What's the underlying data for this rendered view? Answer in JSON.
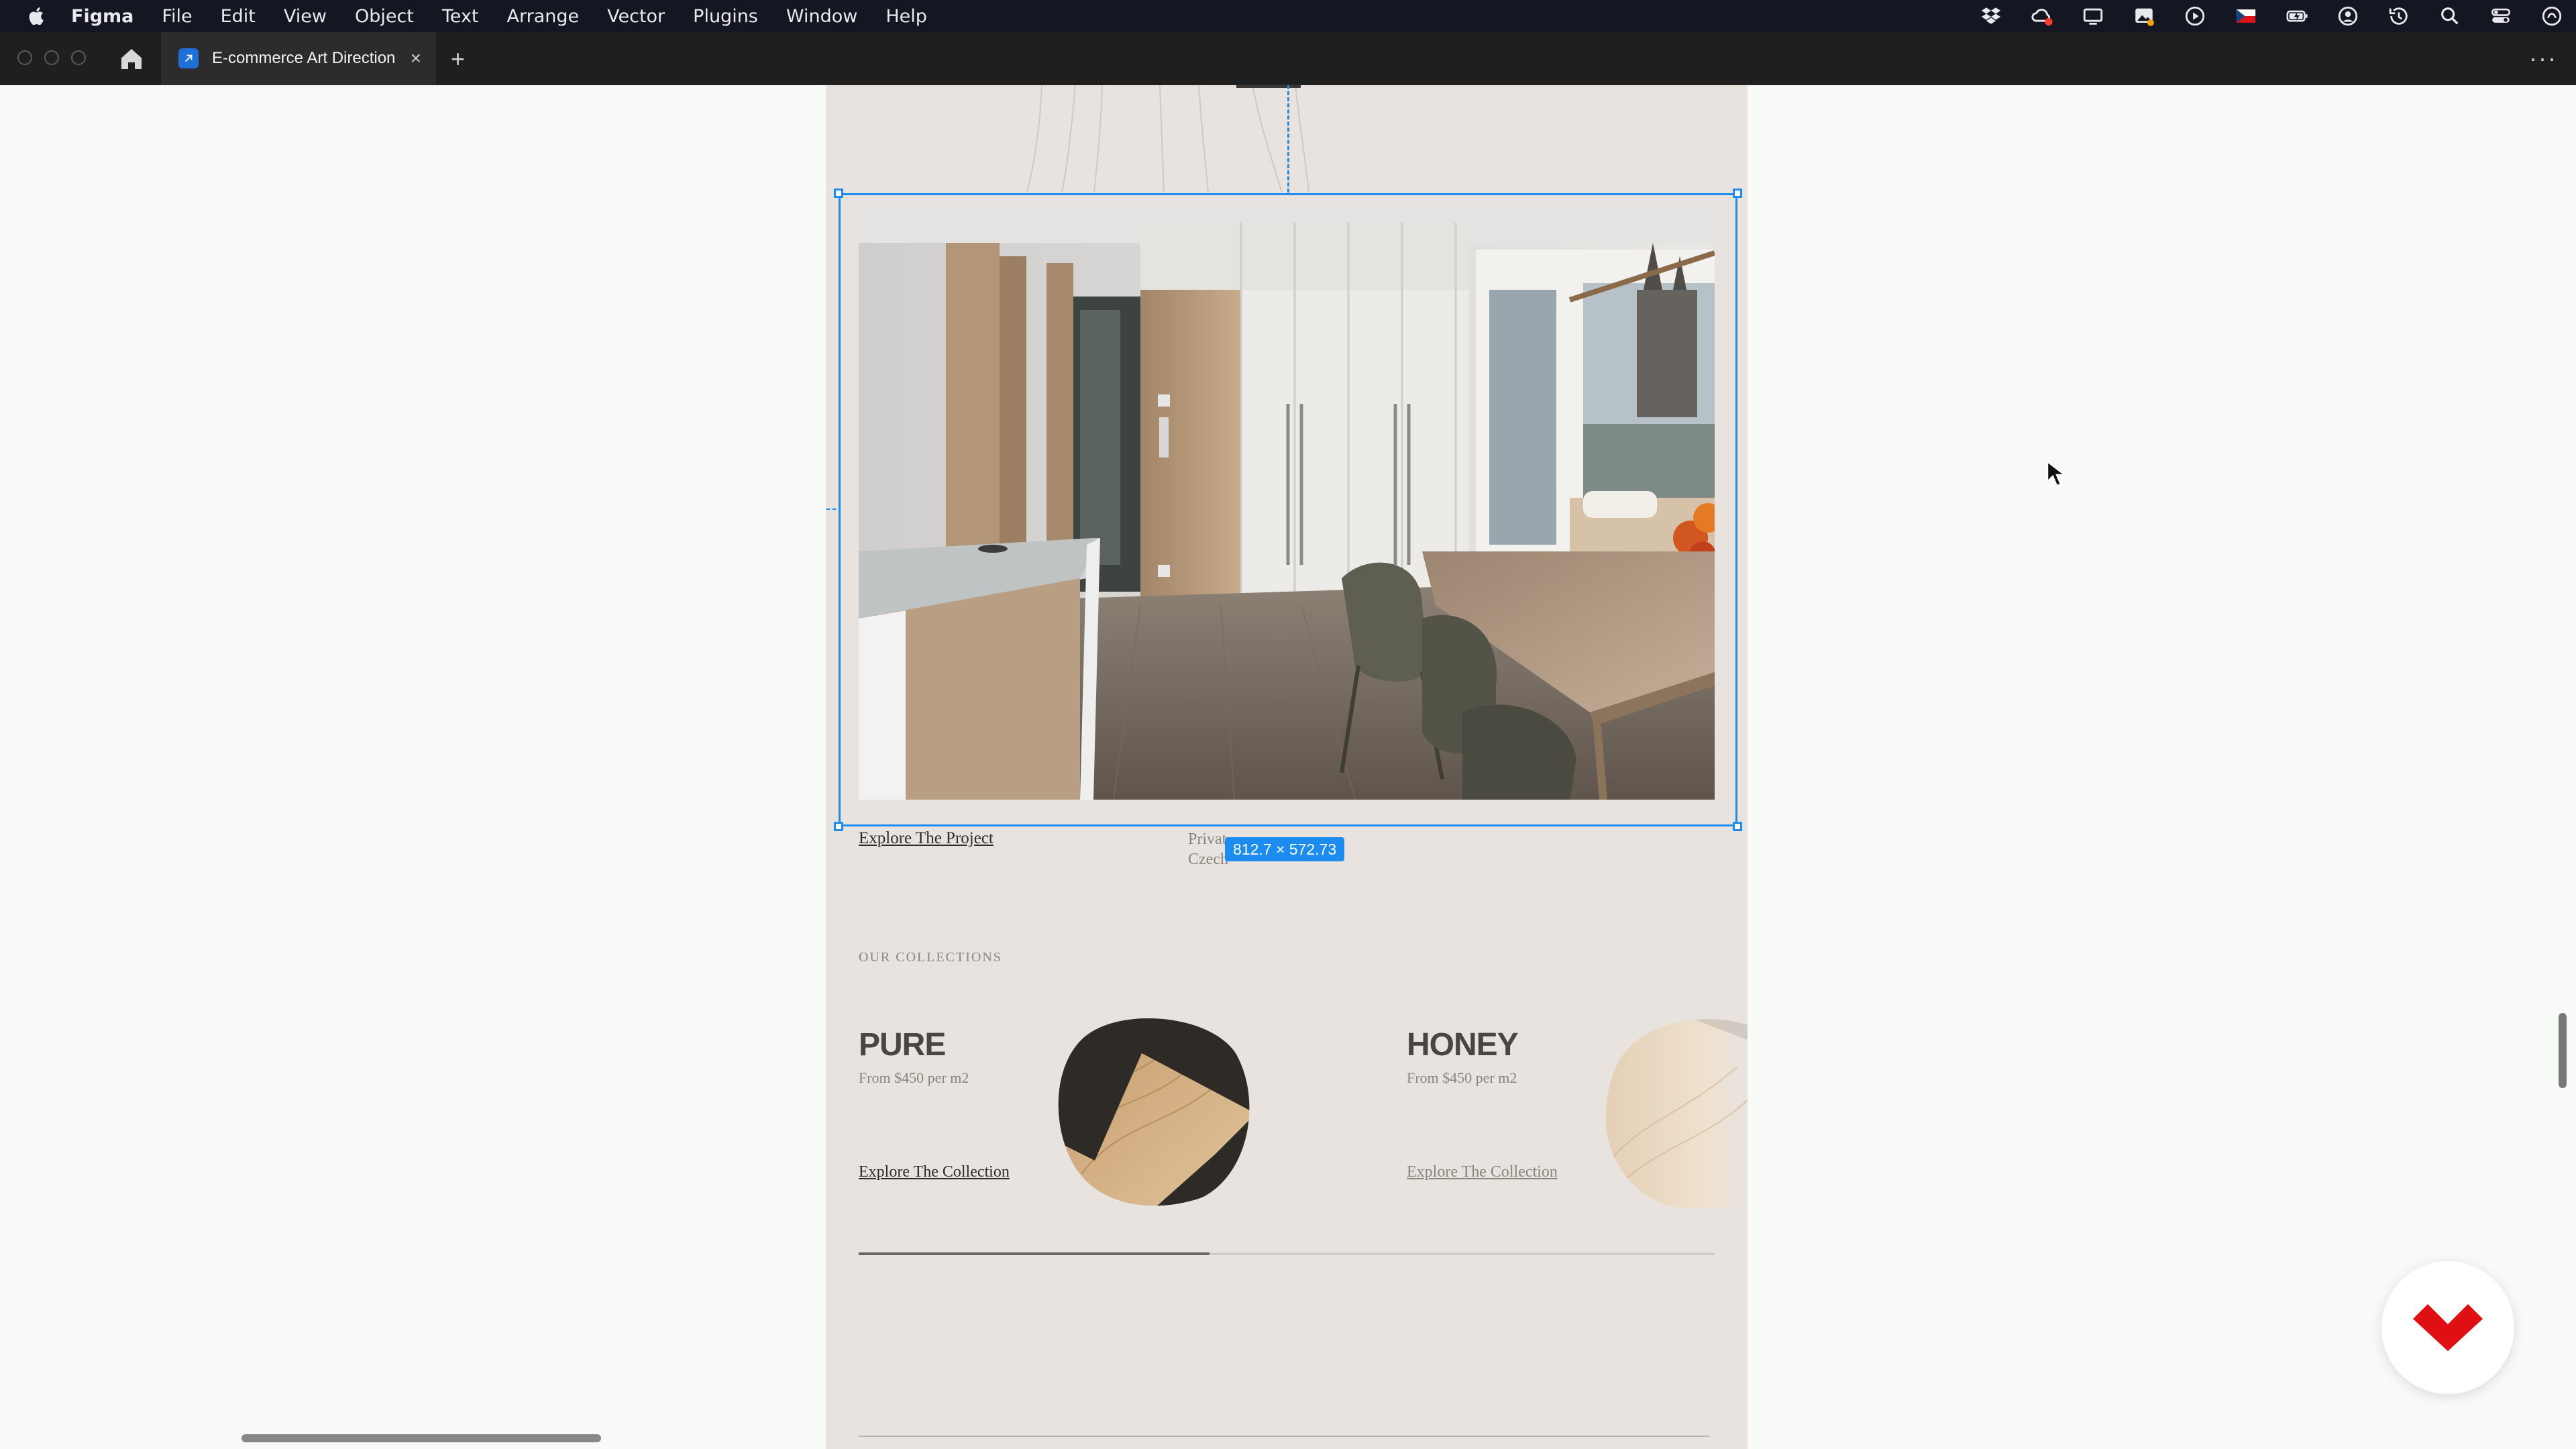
{
  "menubar": {
    "app_name": "Figma",
    "items": [
      "File",
      "Edit",
      "View",
      "Object",
      "Text",
      "Arrange",
      "Vector",
      "Plugins",
      "Window",
      "Help"
    ],
    "status_icons": [
      "dropbox-icon",
      "creative-cloud-icon",
      "display-icon",
      "photos-icon",
      "play-icon",
      "czech-flag-icon",
      "battery-icon",
      "user-icon",
      "time-machine-icon",
      "search-icon",
      "control-center-icon",
      "siri-icon"
    ]
  },
  "tabbar": {
    "tab_title": "E-commerce Art Direction",
    "close_glyph": "×",
    "new_tab_glyph": "+",
    "more_glyph": "···"
  },
  "canvas": {
    "selection_size": "812.7 × 572.73",
    "project_link": "Explore The Project",
    "project_caption_line1": "Privat",
    "project_caption_line2": "Czech",
    "section_label": "OUR COLLECTIONS",
    "collections": [
      {
        "name": "PURE",
        "price": "From $450 per m2",
        "link": "Explore The Collection"
      },
      {
        "name": "HONEY",
        "price": "From $450 per m2",
        "link": "Explore The Collection"
      }
    ],
    "carousel_progress": 0.41
  },
  "colors": {
    "selection_blue": "#1c8cf0",
    "frame_background": "#e8e3df",
    "canvas_background": "#f8faf8",
    "menubar_background": "#141722",
    "tabbar_background": "#1f1f1f",
    "badge_red": "#e00f14"
  }
}
